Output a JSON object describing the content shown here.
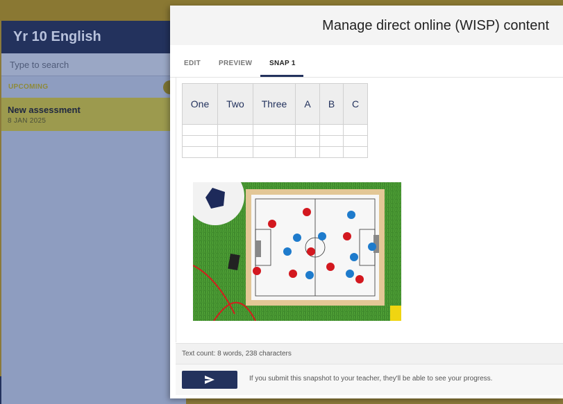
{
  "sidebar": {
    "title": "Yr 10 English",
    "search_placeholder": "Type to search",
    "section_label": "UPCOMING",
    "assessment": {
      "title": "New assessment",
      "date": "8 JAN 2025"
    }
  },
  "modal": {
    "title": "Manage direct online (WISP) content",
    "tabs": [
      {
        "label": "EDIT"
      },
      {
        "label": "PREVIEW"
      },
      {
        "label": "SNAP 1",
        "active": true
      }
    ],
    "table": {
      "headers": [
        "One",
        "Two",
        "Three",
        "A",
        "B",
        "C"
      ],
      "rows": [
        [
          "",
          "",
          "",
          "",
          "",
          ""
        ],
        [
          "",
          "",
          "",
          "",
          "",
          ""
        ],
        [
          "",
          "",
          "",
          "",
          "",
          ""
        ]
      ]
    },
    "image_subject": "football-tactics-board",
    "text_count": "Text count: 8 words, 238 characters",
    "submit_icon": "send-icon",
    "submit_hint": "If you submit this snapshot to your teacher, they'll be able to see your progress."
  },
  "colors": {
    "brand": "#23325d",
    "accent": "#c8b84a"
  }
}
